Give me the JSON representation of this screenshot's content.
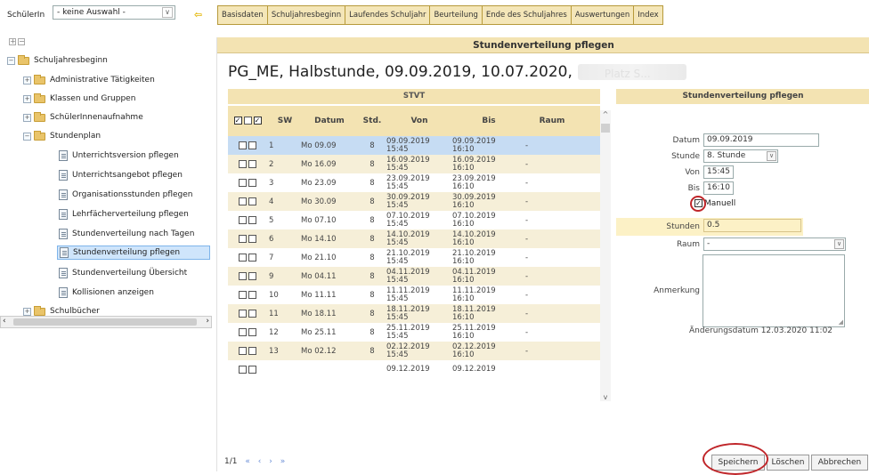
{
  "header": {
    "schueler_label": "SchülerIn",
    "schueler_select": "- keine Auswahl -",
    "tabs": [
      "Basisdaten",
      "Schuljahresbeginn",
      "Laufendes Schuljahr",
      "Beurteilung",
      "Ende des Schuljahres",
      "Auswertungen",
      "Index"
    ]
  },
  "tree": {
    "root": "Schuljahresbeginn",
    "items": [
      "Administrative Tätigkeiten",
      "Klassen und Gruppen",
      "SchülerInnenaufnahme",
      "Stundenplan",
      "Unterrichtsversion pflegen",
      "Unterrichtsangebot pflegen",
      "Organisationsstunden pflegen",
      "Lehrfächerverteilung pflegen",
      "Stundenverteilung nach Tagen",
      "Stundenverteilung pflegen",
      "Stundenverteilung Übersicht",
      "Kollisionen anzeigen",
      "Schulbücher"
    ]
  },
  "main": {
    "header": "Stundenverteilung pflegen",
    "title": "PG_ME, Halbstunde, 09.09.2019, 10.07.2020,",
    "title_blurred_suffix": "Platz S...",
    "stvt_header": "STVT",
    "columns": [
      "SW",
      "Datum",
      "Std.",
      "Von",
      "Bis",
      "Raum"
    ],
    "rows": [
      {
        "sw": "1",
        "datum": "Mo 09.09",
        "std": "8",
        "von_d": "09.09.2019",
        "von_t": "15:45",
        "bis_d": "09.09.2019",
        "bis_t": "16:10",
        "raum": "-"
      },
      {
        "sw": "2",
        "datum": "Mo 16.09",
        "std": "8",
        "von_d": "16.09.2019",
        "von_t": "15:45",
        "bis_d": "16.09.2019",
        "bis_t": "16:10",
        "raum": "-"
      },
      {
        "sw": "3",
        "datum": "Mo 23.09",
        "std": "8",
        "von_d": "23.09.2019",
        "von_t": "15:45",
        "bis_d": "23.09.2019",
        "bis_t": "16:10",
        "raum": "-"
      },
      {
        "sw": "4",
        "datum": "Mo 30.09",
        "std": "8",
        "von_d": "30.09.2019",
        "von_t": "15:45",
        "bis_d": "30.09.2019",
        "bis_t": "16:10",
        "raum": "-"
      },
      {
        "sw": "5",
        "datum": "Mo 07.10",
        "std": "8",
        "von_d": "07.10.2019",
        "von_t": "15:45",
        "bis_d": "07.10.2019",
        "bis_t": "16:10",
        "raum": "-"
      },
      {
        "sw": "6",
        "datum": "Mo 14.10",
        "std": "8",
        "von_d": "14.10.2019",
        "von_t": "15:45",
        "bis_d": "14.10.2019",
        "bis_t": "16:10",
        "raum": "-"
      },
      {
        "sw": "7",
        "datum": "Mo 21.10",
        "std": "8",
        "von_d": "21.10.2019",
        "von_t": "15:45",
        "bis_d": "21.10.2019",
        "bis_t": "16:10",
        "raum": "-"
      },
      {
        "sw": "9",
        "datum": "Mo 04.11",
        "std": "8",
        "von_d": "04.11.2019",
        "von_t": "15:45",
        "bis_d": "04.11.2019",
        "bis_t": "16:10",
        "raum": "-"
      },
      {
        "sw": "10",
        "datum": "Mo 11.11",
        "std": "8",
        "von_d": "11.11.2019",
        "von_t": "15:45",
        "bis_d": "11.11.2019",
        "bis_t": "16:10",
        "raum": "-"
      },
      {
        "sw": "11",
        "datum": "Mo 18.11",
        "std": "8",
        "von_d": "18.11.2019",
        "von_t": "15:45",
        "bis_d": "18.11.2019",
        "bis_t": "16:10",
        "raum": "-"
      },
      {
        "sw": "12",
        "datum": "Mo 25.11",
        "std": "8",
        "von_d": "25.11.2019",
        "von_t": "15:45",
        "bis_d": "25.11.2019",
        "bis_t": "16:10",
        "raum": "-"
      },
      {
        "sw": "13",
        "datum": "Mo 02.12",
        "std": "8",
        "von_d": "02.12.2019",
        "von_t": "15:45",
        "bis_d": "02.12.2019",
        "bis_t": "16:10",
        "raum": "-"
      },
      {
        "sw": "",
        "datum": "",
        "std": "",
        "von_d": "09.12.2019",
        "von_t": "",
        "bis_d": "09.12.2019",
        "bis_t": "",
        "raum": ""
      }
    ],
    "pager": "1/1"
  },
  "form": {
    "header": "Stundenverteilung pflegen",
    "datum_label": "Datum",
    "datum_value": "09.09.2019",
    "stunde_label": "Stunde",
    "stunde_value": "8. Stunde",
    "von_label": "Von",
    "von_value": "15:45",
    "bis_label": "Bis",
    "bis_value": "16:10",
    "manuell_label": "Manuell",
    "manuell_checked": true,
    "stunden_label": "Stunden",
    "stunden_value": "0.5",
    "raum_label": "Raum",
    "raum_value": "-",
    "anmerkung_label": "Anmerkung",
    "aenderungsdatum": "Änderungsdatum  12.03.2020 11:02"
  },
  "buttons": {
    "save": "Speichern",
    "delete": "Löschen",
    "cancel": "Abbrechen"
  },
  "colors": {
    "header_bg": "#f3e3b2",
    "row_odd": "#f6efd8",
    "row_selected": "#c6dcf3",
    "highlight_circle": "#c0262a"
  }
}
